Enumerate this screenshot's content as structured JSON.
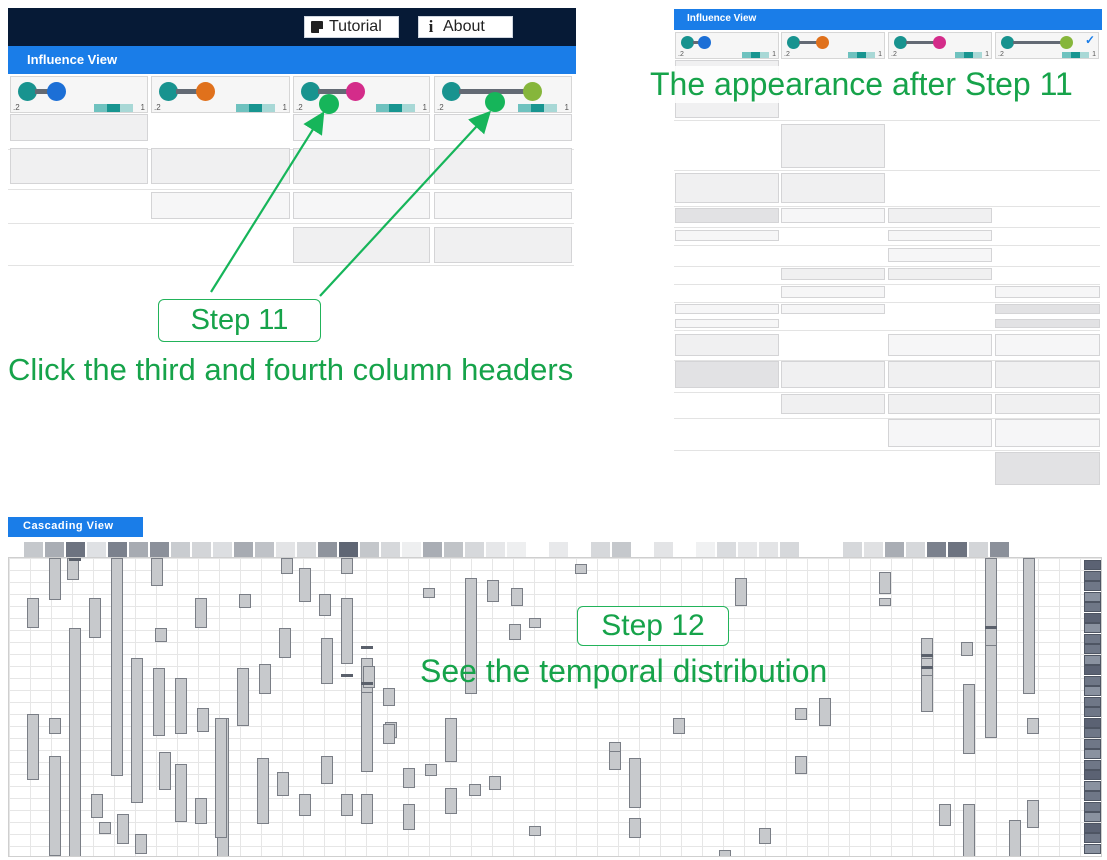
{
  "toolbar": {
    "tutorial_label": "Tutorial",
    "about_label": "About",
    "tutorial_icon": "document-icon",
    "about_icon": "info-icon"
  },
  "influence_view": {
    "title": "Influence View",
    "columns": [
      {
        "node_a": "#18938f",
        "node_b": "#1c6fd6",
        "edge": "short",
        "range_low": ".2",
        "range_high": "1"
      },
      {
        "node_a": "#18938f",
        "node_b": "#e0711c",
        "edge": "medium",
        "range_low": ".2",
        "range_high": "1"
      },
      {
        "node_a": "#18938f",
        "node_b": "#d42c8a",
        "edge": "long",
        "range_low": ".2",
        "range_high": "1"
      },
      {
        "node_a": "#18938f",
        "node_b": "#86b63b",
        "edge": "longest",
        "range_low": ".2",
        "range_high": "1"
      }
    ]
  },
  "after_view": {
    "title": "Influence View",
    "columns": [
      {
        "node_a": "#18938f",
        "node_b": "#1c6fd6",
        "range_low": ".2",
        "range_high": "1",
        "checked": false
      },
      {
        "node_a": "#18938f",
        "node_b": "#e0711c",
        "range_low": ".2",
        "range_high": "1",
        "checked": false
      },
      {
        "node_a": "#18938f",
        "node_b": "#d42c8a",
        "range_low": ".2",
        "range_high": "1",
        "checked": false
      },
      {
        "node_a": "#18938f",
        "node_b": "#86b63b",
        "range_low": ".2",
        "range_high": "1",
        "checked": true
      }
    ]
  },
  "annotations": {
    "after_caption": "The appearance after Step 11",
    "step11_label": "Step 11",
    "step11_text": "Click the third and fourth column headers",
    "step12_label": "Step 12",
    "step12_text": "See the temporal distribution",
    "accent_color": "#16a34a"
  },
  "cascading_view": {
    "title": "Cascading View"
  }
}
